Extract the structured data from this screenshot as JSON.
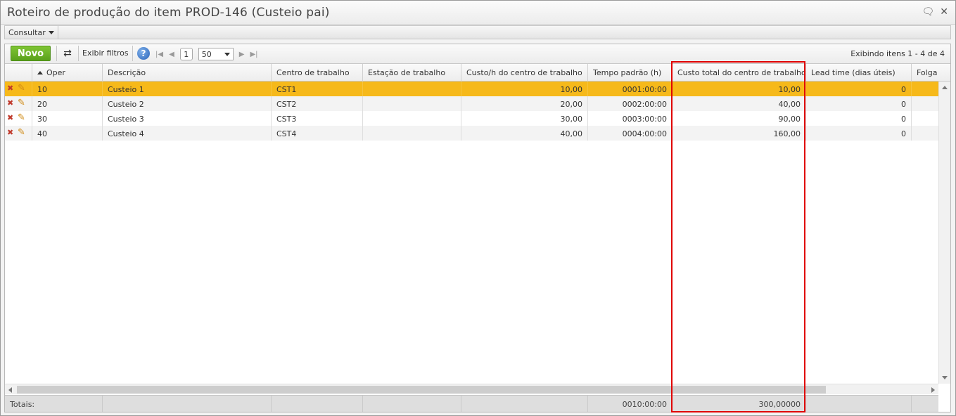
{
  "window": {
    "title": "Roteiro de produção do item PROD-146 (Custeio pai)",
    "comment_icon": "comment-icon",
    "close_icon": "close-icon"
  },
  "menu": {
    "consultar": "Consultar"
  },
  "toolbar": {
    "novo": "Novo",
    "exibir_filtros": "Exibir filtros",
    "page": "1",
    "page_size": "50",
    "showing": "Exibindo itens 1 - 4 de 4"
  },
  "columns": [
    "Oper",
    "Descrição",
    "Centro de trabalho",
    "Estação de trabalho",
    "Custo/h do centro de trabalho",
    "Tempo padrão (h)",
    "Custo total do centro de trabalho",
    "Lead time (dias úteis)",
    "Folga"
  ],
  "rows": [
    {
      "oper": "10",
      "descricao": "Custeio 1",
      "centro": "CST1",
      "estacao": "",
      "custo_h": "10,00",
      "tempo": "0001:00:00",
      "custo_total": "10,00",
      "lead_time": "0"
    },
    {
      "oper": "20",
      "descricao": "Custeio 2",
      "centro": "CST2",
      "estacao": "",
      "custo_h": "20,00",
      "tempo": "0002:00:00",
      "custo_total": "40,00",
      "lead_time": "0"
    },
    {
      "oper": "30",
      "descricao": "Custeio 3",
      "centro": "CST3",
      "estacao": "",
      "custo_h": "30,00",
      "tempo": "0003:00:00",
      "custo_total": "90,00",
      "lead_time": "0"
    },
    {
      "oper": "40",
      "descricao": "Custeio 4",
      "centro": "CST4",
      "estacao": "",
      "custo_h": "40,00",
      "tempo": "0004:00:00",
      "custo_total": "160,00",
      "lead_time": "0"
    }
  ],
  "totals": {
    "label": "Totais:",
    "tempo": "0010:00:00",
    "custo_total": "300,00000"
  },
  "colors": {
    "selected_row": "#f6b91a",
    "novo_button": "#6db42a",
    "highlight_box": "#e00000"
  }
}
